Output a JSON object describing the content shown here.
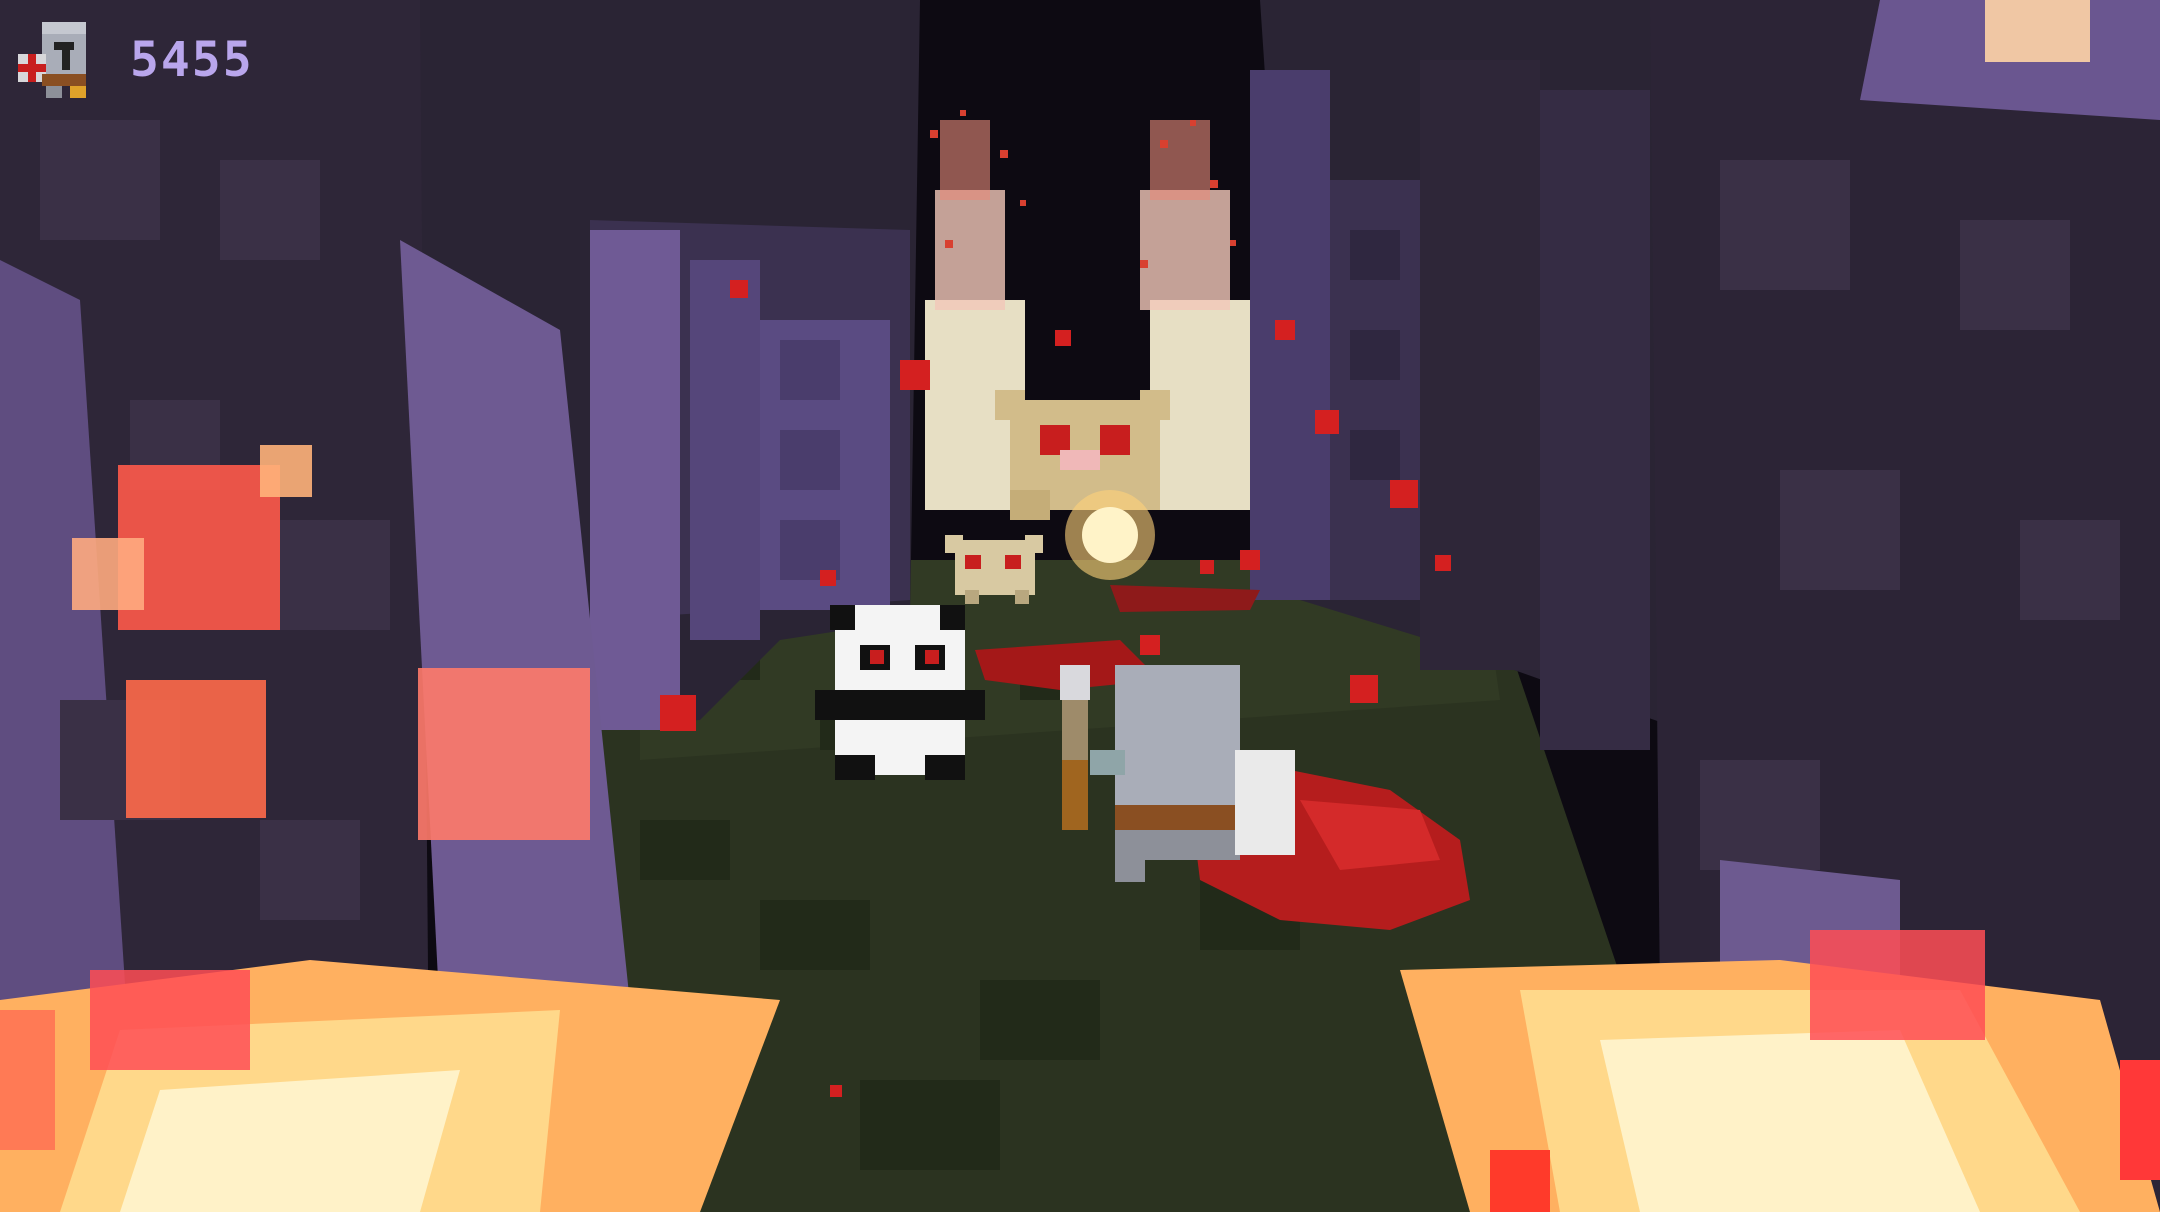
{
  "hud": {
    "score": "5455",
    "score_color": "#b9a6ec",
    "player_icon": "knight-helmet-icon"
  },
  "scene": {
    "description_icons": [
      "knight-player",
      "panda-enemy",
      "fox-enemy",
      "golden-boss-enemy",
      "fireball",
      "lava-pool"
    ],
    "colors": {
      "sky": "#0d0a12",
      "wall_dark": "#2a2434",
      "wall_mid": "#3c3150",
      "wall_light": "#6f5a95",
      "floor": "#2b3320",
      "blood": "#b51d1d",
      "lava_yellow": "#fff2a8",
      "lava_orange": "#ffb060",
      "lava_red": "#ff5a4a",
      "knight_armor": "#a9adb8",
      "panda_white": "#f4f4f4",
      "boss_tan": "#d2bc8a"
    }
  }
}
